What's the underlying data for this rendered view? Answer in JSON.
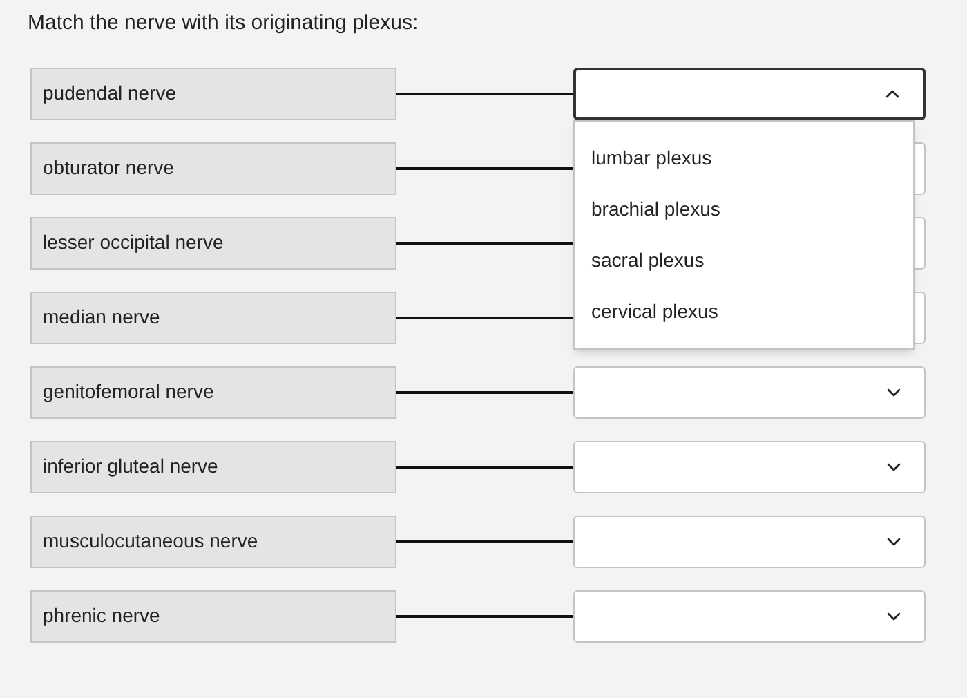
{
  "title": "Match the nerve with its originating plexus:",
  "rows": [
    {
      "nerve": "pudendal nerve",
      "expanded": true
    },
    {
      "nerve": "obturator nerve",
      "expanded": false
    },
    {
      "nerve": "lesser occipital nerve",
      "expanded": false
    },
    {
      "nerve": "median nerve",
      "expanded": false
    },
    {
      "nerve": "genitofemoral nerve",
      "expanded": false
    },
    {
      "nerve": "inferior gluteal nerve",
      "expanded": false
    },
    {
      "nerve": "musculocutaneous nerve",
      "expanded": false
    },
    {
      "nerve": "phrenic nerve",
      "expanded": false
    }
  ],
  "options": [
    {
      "label": "lumbar plexus",
      "selected": false
    },
    {
      "label": "brachial plexus",
      "selected": false
    },
    {
      "label": "sacral plexus",
      "selected": false
    },
    {
      "label": "cervical plexus",
      "selected": false
    }
  ]
}
